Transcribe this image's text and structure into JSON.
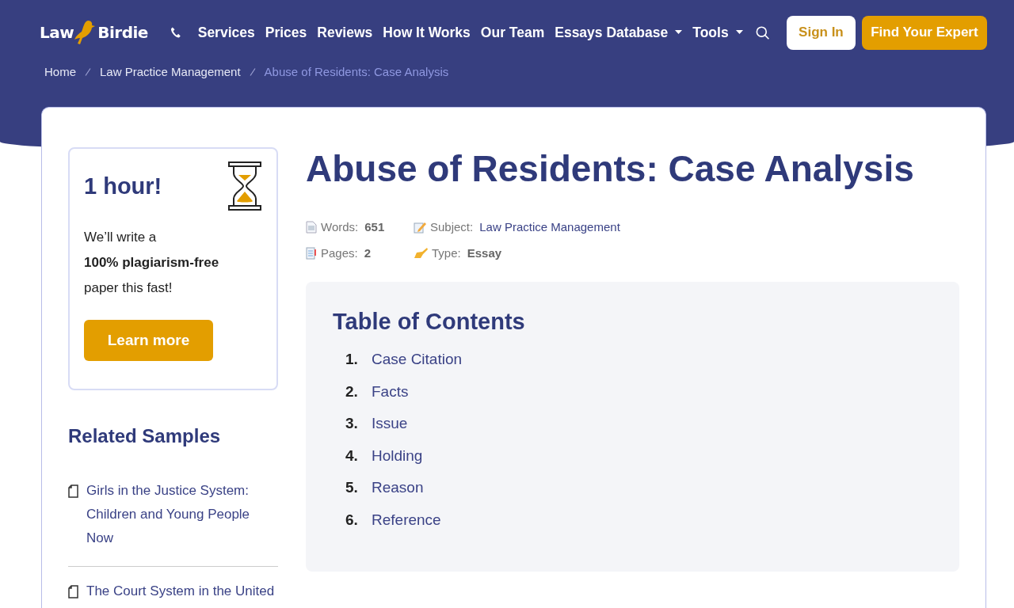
{
  "header": {
    "logo_left": "Law",
    "logo_right": "Birdie",
    "nav": [
      {
        "label": "Services",
        "dropdown": false
      },
      {
        "label": "Prices",
        "dropdown": false
      },
      {
        "label": "Reviews",
        "dropdown": false
      },
      {
        "label": "How It Works",
        "dropdown": false
      },
      {
        "label": "Our Team",
        "dropdown": false
      },
      {
        "label": "Essays Database",
        "dropdown": true
      },
      {
        "label": "Tools",
        "dropdown": true
      }
    ],
    "sign_in": "Sign In",
    "cta": "Find Your Expert"
  },
  "breadcrumbs": [
    {
      "label": "Home",
      "current": false
    },
    {
      "label": "Law Practice Management",
      "current": false
    },
    {
      "label": "Abuse of Residents: Case Analysis",
      "current": true
    }
  ],
  "promo": {
    "title": "1 hour!",
    "lines": [
      "We’ll write a",
      "**100% plagiarism-free**",
      "paper this fast!"
    ],
    "button": "Learn more"
  },
  "related": {
    "title": "Related Samples",
    "items": [
      "Girls in the Justice System: Children and Young People Now",
      "The Court System in the United"
    ]
  },
  "article": {
    "title": "Abuse of Residents: Case Analysis",
    "meta": [
      {
        "kind": "words",
        "label": "Words:",
        "value": "651"
      },
      {
        "kind": "subject",
        "label": "Subject:",
        "value": "Law Practice Management"
      },
      {
        "kind": "pages",
        "label": "Pages:",
        "value": "2"
      },
      {
        "kind": "type",
        "label": "Type:",
        "value": "Essay"
      }
    ],
    "toc": {
      "title": "Table of Contents",
      "items": [
        {
          "number": "1.",
          "label": "Case Citation"
        },
        {
          "number": "2.",
          "label": "Facts"
        },
        {
          "number": "3.",
          "label": "Issue"
        },
        {
          "number": "4.",
          "label": "Holding"
        },
        {
          "number": "5.",
          "label": "Reason"
        },
        {
          "number": "6.",
          "label": "Reference"
        }
      ]
    }
  }
}
